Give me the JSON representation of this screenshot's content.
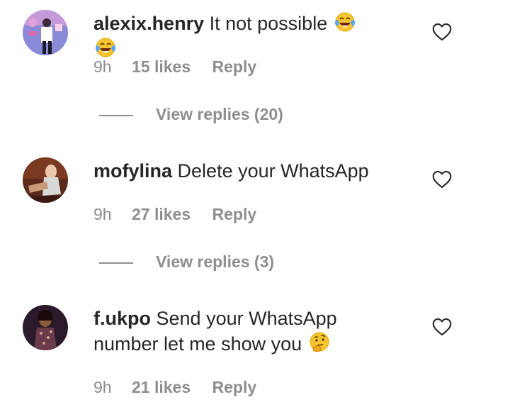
{
  "comments": [
    {
      "username": "alexix.henry",
      "text": "It not possible",
      "emoji": [
        "face-with-tears-of-joy-emoji",
        "face-with-tears-of-joy-emoji"
      ],
      "time": "9h",
      "likes": "15 likes",
      "reply": "Reply",
      "view_replies": "View replies (20)"
    },
    {
      "username": "mofylina",
      "text": "Delete your WhatsApp",
      "time": "9h",
      "likes": "27 likes",
      "reply": "Reply",
      "view_replies": "View replies (3)"
    },
    {
      "username": "f.ukpo",
      "text": "Send your WhatsApp number let me show you",
      "emoji": [
        "thinking-face-emoji"
      ],
      "time": "9h",
      "likes": "21 likes",
      "reply": "Reply"
    }
  ],
  "icons": {
    "like": "heart-outline-icon"
  },
  "colors": {
    "text": "#262626",
    "secondary": "#8e8e8e",
    "background": "#ffffff"
  }
}
